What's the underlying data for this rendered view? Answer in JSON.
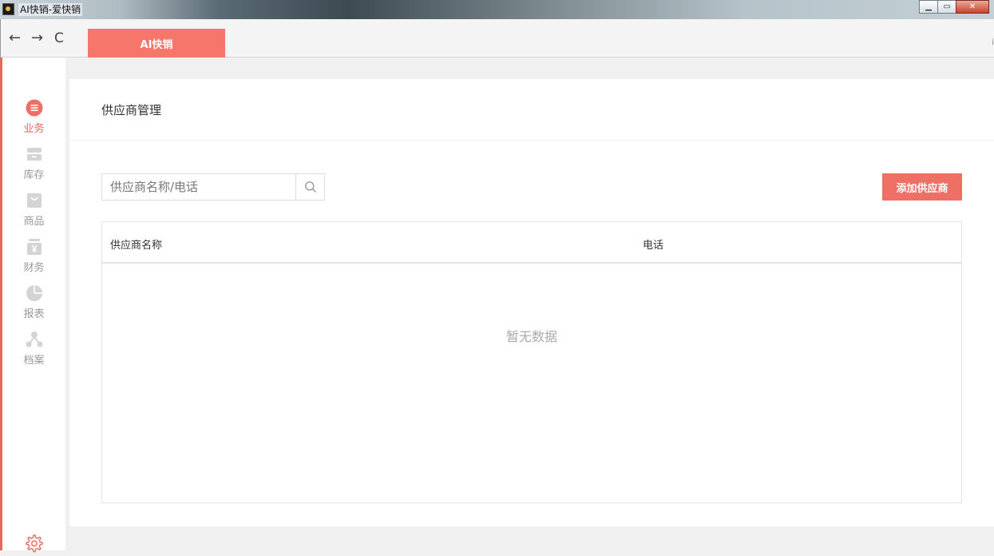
{
  "window": {
    "title": "AI快销-爱快销",
    "controls": {
      "minimize": "▁",
      "maximize": "▭",
      "close": "✕"
    }
  },
  "browser": {
    "back": "←",
    "forward": "→",
    "reload": "C",
    "tab_label": "AI快销",
    "right_glyph": "i"
  },
  "sidebar": {
    "items": [
      {
        "label": "业务",
        "icon": "list-icon",
        "active": true
      },
      {
        "label": "库存",
        "icon": "inventory-icon",
        "active": false
      },
      {
        "label": "商品",
        "icon": "bag-icon",
        "active": false
      },
      {
        "label": "财务",
        "icon": "yen-icon",
        "active": false
      },
      {
        "label": "报表",
        "icon": "pie-chart-icon",
        "active": false
      },
      {
        "label": "档案",
        "icon": "network-icon",
        "active": false
      }
    ],
    "settings_icon": "gear-icon"
  },
  "page": {
    "title": "供应商管理",
    "search": {
      "placeholder": "供应商名称/电话",
      "value": ""
    },
    "add_button": "添加供应商",
    "table": {
      "columns": [
        "供应商名称",
        "电话"
      ],
      "rows": [],
      "empty_text": "暂无数据"
    }
  },
  "colors": {
    "accent": "#ee6f65",
    "tab": "#f7766b",
    "inactive_icon": "#d4d4d4"
  }
}
